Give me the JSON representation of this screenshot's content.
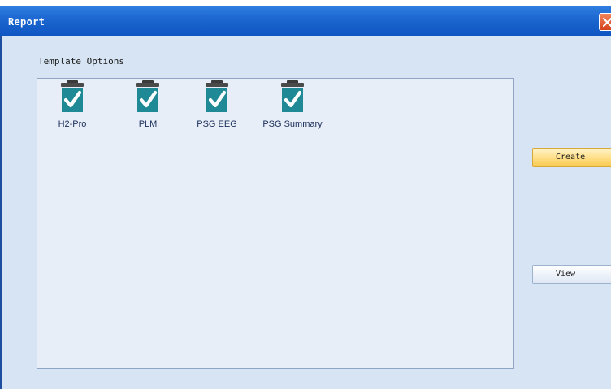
{
  "window": {
    "title": "Report"
  },
  "template_options": {
    "label": "Template Options",
    "items": [
      {
        "label": "H2-Pro",
        "checked": true
      },
      {
        "label": "PLM",
        "checked": true
      },
      {
        "label": "PSG EEG",
        "checked": true
      },
      {
        "label": "PSG Summary",
        "checked": true
      }
    ]
  },
  "actions": {
    "create_label": "Create",
    "view_label": "View"
  },
  "colors": {
    "titlebar": "#1b66cf",
    "window_bg": "#d6e4f3",
    "panel_bg": "#e8eef7",
    "check_teal": "#1f8a95",
    "create_button": "#ffe08a"
  }
}
